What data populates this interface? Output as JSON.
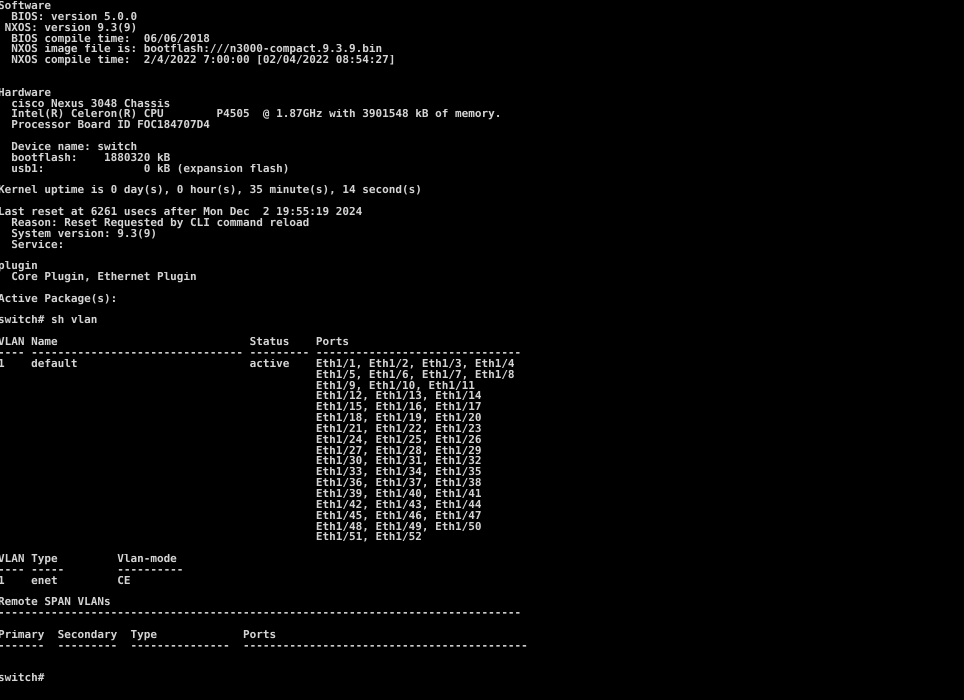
{
  "terminal": {
    "title": "switch terminal",
    "prompt": "switch#",
    "foreground_color": "#d4d4d4",
    "background_color": "#000000",
    "command_entered": "sh vlan",
    "lines": [
      "Software",
      "  BIOS: version 5.0.0",
      " NXOS: version 9.3(9)",
      "  BIOS compile time:  06/06/2018",
      "  NXOS image file is: bootflash:///n3000-compact.9.3.9.bin",
      "  NXOS compile time:  2/4/2022 7:00:00 [02/04/2022 08:54:27]",
      "",
      "",
      "Hardware",
      "  cisco Nexus 3048 Chassis",
      "  Intel(R) Celeron(R) CPU        P4505  @ 1.87GHz with 3901548 kB of memory.",
      "  Processor Board ID FOC184707D4",
      "",
      "  Device name: switch",
      "  bootflash:    1880320 kB",
      "  usb1:               0 kB (expansion flash)",
      "",
      "Kernel uptime is 0 day(s), 0 hour(s), 35 minute(s), 14 second(s)",
      "",
      "Last reset at 6261 usecs after Mon Dec  2 19:55:19 2024",
      "  Reason: Reset Requested by CLI command reload",
      "  System version: 9.3(9)",
      "  Service:",
      "",
      "plugin",
      "  Core Plugin, Ethernet Plugin",
      "",
      "Active Package(s):",
      "",
      "switch# sh vlan",
      "",
      "VLAN Name                             Status    Ports",
      "---- -------------------------------- --------- -------------------------------",
      "1    default                          active    Eth1/1, Eth1/2, Eth1/3, Eth1/4",
      "                                                Eth1/5, Eth1/6, Eth1/7, Eth1/8",
      "                                                Eth1/9, Eth1/10, Eth1/11",
      "                                                Eth1/12, Eth1/13, Eth1/14",
      "                                                Eth1/15, Eth1/16, Eth1/17",
      "                                                Eth1/18, Eth1/19, Eth1/20",
      "                                                Eth1/21, Eth1/22, Eth1/23",
      "                                                Eth1/24, Eth1/25, Eth1/26",
      "                                                Eth1/27, Eth1/28, Eth1/29",
      "                                                Eth1/30, Eth1/31, Eth1/32",
      "                                                Eth1/33, Eth1/34, Eth1/35",
      "                                                Eth1/36, Eth1/37, Eth1/38",
      "                                                Eth1/39, Eth1/40, Eth1/41",
      "                                                Eth1/42, Eth1/43, Eth1/44",
      "                                                Eth1/45, Eth1/46, Eth1/47",
      "                                                Eth1/48, Eth1/49, Eth1/50",
      "                                                Eth1/51, Eth1/52",
      "",
      "VLAN Type         Vlan-mode",
      "---- -----        ----------",
      "1    enet         CE",
      "",
      "Remote SPAN VLANs",
      "-------------------------------------------------------------------------------",
      "",
      "Primary  Secondary  Type             Ports",
      "-------  ---------  ---------------  -------------------------------------------",
      "",
      "",
      "switch#"
    ]
  }
}
